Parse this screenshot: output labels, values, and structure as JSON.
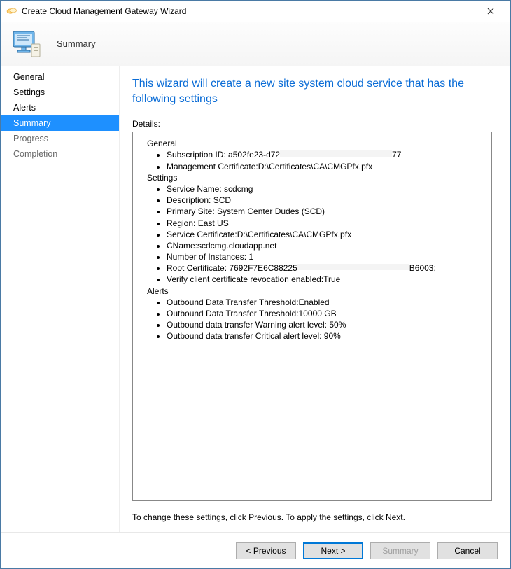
{
  "window": {
    "title": "Create Cloud Management Gateway Wizard"
  },
  "header": {
    "page_title": "Summary"
  },
  "sidebar": {
    "items": [
      {
        "label": "General",
        "state": "normal"
      },
      {
        "label": "Settings",
        "state": "normal"
      },
      {
        "label": "Alerts",
        "state": "normal"
      },
      {
        "label": "Summary",
        "state": "selected"
      },
      {
        "label": "Progress",
        "state": "muted"
      },
      {
        "label": "Completion",
        "state": "muted"
      }
    ]
  },
  "main": {
    "heading": "This wizard will create a new site system cloud service that has the following settings",
    "details_label": "Details:",
    "details": {
      "general": {
        "title": "General",
        "items": [
          {
            "prefix": "Subscription ID: a502fe23-d72",
            "redacted": true,
            "suffix": "77"
          },
          {
            "text": "Management Certificate:D:\\Certificates\\CA\\CMGPfx.pfx"
          }
        ]
      },
      "settings": {
        "title": "Settings",
        "items": [
          {
            "text": "Service Name: scdcmg"
          },
          {
            "text": "Description: SCD"
          },
          {
            "text": "Primary Site: System Center Dudes (SCD)"
          },
          {
            "text": "Region: East US"
          },
          {
            "text": "Service Certificate:D:\\Certificates\\CA\\CMGPfx.pfx"
          },
          {
            "text": "CName:scdcmg.cloudapp.net"
          },
          {
            "text": "Number of Instances: 1"
          },
          {
            "prefix": "Root Certificate: 7692F7E6C88225",
            "redacted": true,
            "suffix": "B6003;"
          },
          {
            "text": "Verify client certificate revocation enabled:True"
          }
        ]
      },
      "alerts": {
        "title": "Alerts",
        "items": [
          {
            "text": "Outbound Data Transfer Threshold:Enabled"
          },
          {
            "text": "Outbound Data Transfer Threshold:10000 GB"
          },
          {
            "text": "Outbound data transfer Warning alert level: 50%"
          },
          {
            "text": "Outbound data transfer Critical alert level: 90%"
          }
        ]
      }
    },
    "bottom_hint": "To change these settings, click Previous. To apply the settings, click Next."
  },
  "footer": {
    "previous": "< Previous",
    "next": "Next >",
    "summary": "Summary",
    "cancel": "Cancel"
  }
}
